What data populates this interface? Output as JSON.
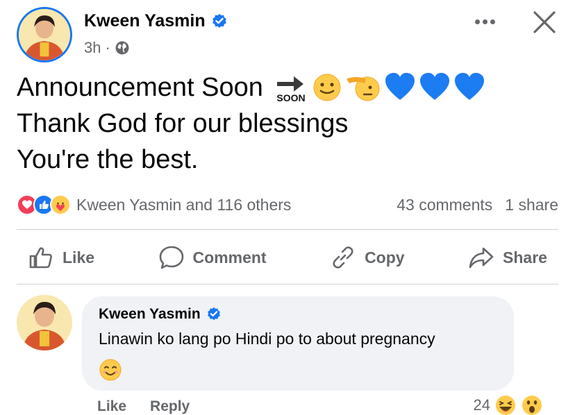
{
  "post": {
    "author": "Kween Yasmin",
    "time": "3h",
    "separator": "·",
    "lines": [
      "Announcement Soon",
      "Thank God for our blessings",
      "You're the best."
    ],
    "soon_label": "SOON",
    "emojis": [
      "soon-arrow",
      "slightly-smiling-face",
      "saluting-face",
      "blue-heart",
      "blue-heart",
      "blue-heart"
    ]
  },
  "reactions": {
    "summary": "Kween Yasmin and 116 others",
    "icons": [
      "love",
      "like",
      "care"
    ],
    "comments": "43 comments",
    "shares": "1 share"
  },
  "actions": {
    "like": "Like",
    "comment": "Comment",
    "copy": "Copy",
    "share": "Share"
  },
  "comment": {
    "author": "Kween Yasmin",
    "text": "Linawin ko lang po Hindi po to about pregnancy",
    "emoji": "smiling-face-with-smiling-eyes",
    "like_label": "Like",
    "reply_label": "Reply",
    "reaction_count": "24",
    "reaction_icons": [
      "haha",
      "wow"
    ]
  },
  "colors": {
    "brand_blue": "#1877f2",
    "text": "#050505",
    "muted": "#65676b",
    "bubble": "#f0f2f5",
    "love_red": "#f33e58",
    "emoji_yellow": "#ffcb4c"
  }
}
